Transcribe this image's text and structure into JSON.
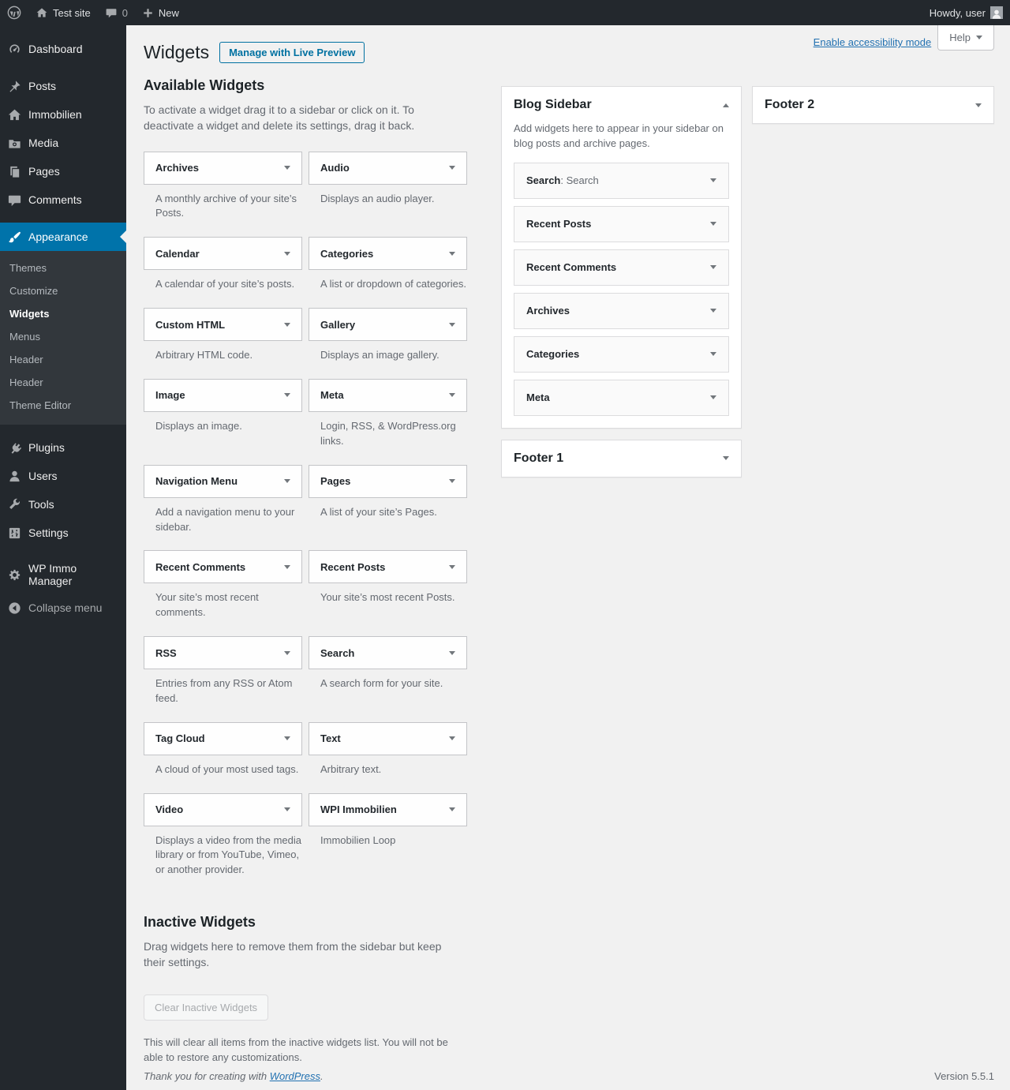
{
  "colors": {
    "accent": "#0073aa",
    "link": "#2271b1",
    "menu_bg": "#23282d",
    "submenu_bg": "#32373c",
    "page_bg": "#f1f1f1"
  },
  "admin_bar": {
    "site_name": "Test site",
    "comments_count": "0",
    "new_label": "New",
    "howdy_text": "Howdy, user"
  },
  "menu": {
    "items": [
      {
        "label": "Dashboard",
        "icon": "dashboard-icon"
      },
      {
        "label": "Posts",
        "icon": "pin-icon"
      },
      {
        "label": "Immobilien",
        "icon": "house-icon"
      },
      {
        "label": "Media",
        "icon": "camera-icon"
      },
      {
        "label": "Pages",
        "icon": "pages-icon"
      },
      {
        "label": "Comments",
        "icon": "comment-icon"
      },
      {
        "label": "Appearance",
        "icon": "brush-icon"
      },
      {
        "label": "Plugins",
        "icon": "plugin-icon"
      },
      {
        "label": "Users",
        "icon": "user-icon"
      },
      {
        "label": "Tools",
        "icon": "wrench-icon"
      },
      {
        "label": "Settings",
        "icon": "sliders-icon"
      },
      {
        "label": "WP Immo Manager",
        "icon": "gear-icon"
      },
      {
        "label": "Collapse menu",
        "icon": "collapse-icon"
      }
    ],
    "appearance_submenu": [
      "Themes",
      "Customize",
      "Widgets",
      "Menus",
      "Header",
      "Header",
      "Theme Editor"
    ]
  },
  "page": {
    "title": "Widgets",
    "manage_button": "Manage with Live Preview",
    "accessibility_link": "Enable accessibility mode",
    "help_label": "Help"
  },
  "available": {
    "heading": "Available Widgets",
    "intro": "To activate a widget drag it to a sidebar or click on it. To deactivate a widget and delete its settings, drag it back.",
    "widgets": [
      {
        "title": "Archives",
        "desc": "A monthly archive of your site’s Posts."
      },
      {
        "title": "Audio",
        "desc": "Displays an audio player."
      },
      {
        "title": "Calendar",
        "desc": "A calendar of your site’s posts."
      },
      {
        "title": "Categories",
        "desc": "A list or dropdown of categories."
      },
      {
        "title": "Custom HTML",
        "desc": "Arbitrary HTML code."
      },
      {
        "title": "Gallery",
        "desc": "Displays an image gallery."
      },
      {
        "title": "Image",
        "desc": "Displays an image."
      },
      {
        "title": "Meta",
        "desc": "Login, RSS, & WordPress.org links."
      },
      {
        "title": "Navigation Menu",
        "desc": "Add a navigation menu to your sidebar."
      },
      {
        "title": "Pages",
        "desc": "A list of your site’s Pages."
      },
      {
        "title": "Recent Comments",
        "desc": "Your site’s most recent comments."
      },
      {
        "title": "Recent Posts",
        "desc": "Your site’s most recent Posts."
      },
      {
        "title": "RSS",
        "desc": "Entries from any RSS or Atom feed."
      },
      {
        "title": "Search",
        "desc": "A search form for your site."
      },
      {
        "title": "Tag Cloud",
        "desc": "A cloud of your most used tags."
      },
      {
        "title": "Text",
        "desc": "Arbitrary text."
      },
      {
        "title": "Video",
        "desc": "Displays a video from the media library or from YouTube, Vimeo, or another provider."
      },
      {
        "title": "WPI Immobilien",
        "desc": "Immobilien Loop"
      }
    ]
  },
  "inactive": {
    "heading": "Inactive Widgets",
    "intro": "Drag widgets here to remove them from the sidebar but keep their settings.",
    "clear_button": "Clear Inactive Widgets",
    "note": "This will clear all items from the inactive widgets list. You will not be able to restore any customizations."
  },
  "blog_sidebar": {
    "title": "Blog Sidebar",
    "description": "Add widgets here to appear in your sidebar on blog posts and archive pages.",
    "widgets": [
      {
        "title": "Search",
        "subtitle": ": Search"
      },
      {
        "title": "Recent Posts",
        "subtitle": ""
      },
      {
        "title": "Recent Comments",
        "subtitle": ""
      },
      {
        "title": "Archives",
        "subtitle": ""
      },
      {
        "title": "Categories",
        "subtitle": ""
      },
      {
        "title": "Meta",
        "subtitle": ""
      }
    ]
  },
  "footer1": {
    "title": "Footer 1"
  },
  "footer2": {
    "title": "Footer 2"
  },
  "footer": {
    "thanks_prefix": "Thank you for creating with ",
    "wordpress_link": "WordPress",
    "thanks_suffix": ".",
    "version": "Version 5.5.1"
  }
}
